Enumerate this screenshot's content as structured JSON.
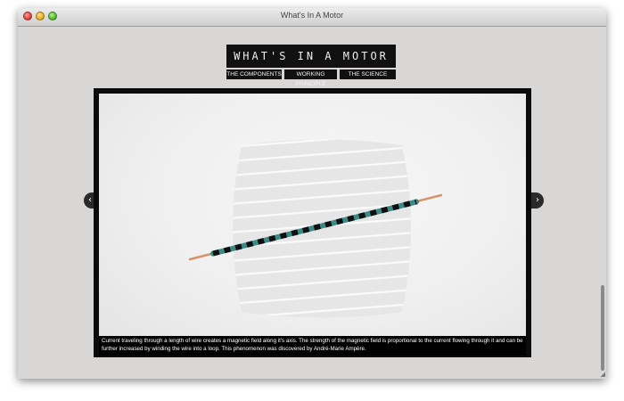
{
  "window": {
    "title": "What's In A Motor"
  },
  "site": {
    "logo": "WHAT'S IN A MOTOR"
  },
  "nav": {
    "items": [
      "THE COMPONENTS",
      "WORKING PRINCIPLE",
      "THE SCIENCE"
    ]
  },
  "slide": {
    "caption": "Current traveling through a length of wire creates a magnetic field along it's axis. The strength of the magnetic field is proportional to the current flowing through it and can be further increased by winding the wire into a loop. This phenomenon was discovered by André-Marie Ampère."
  },
  "icons": {
    "prev": "chevron-left-icon",
    "next": "chevron-right-icon",
    "resize": "resize-grip-icon"
  },
  "glyphs": {
    "prev": "‹",
    "next": "›",
    "resize": "◢"
  },
  "colors": {
    "window_bg": "#d9d6d6",
    "nav_bg": "#111111",
    "wire_copper": "#d9926a",
    "wire_teal": "#3b8a86"
  }
}
